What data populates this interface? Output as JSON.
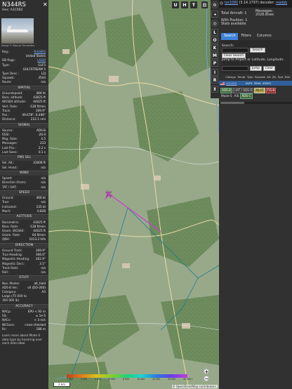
{
  "left_panel": {
    "callsign": "N344RS",
    "hex": "Hex:  A3C0B2",
    "photo_credit": "Image © Manuel Fernandez",
    "details": [
      {
        "label": "Reg.:",
        "value": "N344RS",
        "link": true
      },
      {
        "label": "",
        "value": "United States",
        "link": false
      },
      {
        "label": "DB flags:",
        "value": "LADD",
        "link": true
      },
      {
        "label": "Type:",
        "value": "GLF5",
        "link": false
      },
      {
        "label": "",
        "value": "GULFSTREAM 5",
        "link": false
      },
      {
        "label": "Type Desc.:",
        "value": "L2J",
        "link": false
      },
      {
        "label": "Squawk:",
        "value": "3544",
        "link": false
      },
      {
        "label": "Route:",
        "value": "n/a",
        "link": false
      }
    ],
    "sections": [
      {
        "title": "SPATIAL",
        "rows": [
          {
            "label": "Groundspeed:",
            "value": "466 kt"
          },
          {
            "label": "Baro. altitude:",
            "value": "43025 ft"
          },
          {
            "label": "WGS84 altitude:",
            "value": "44025 ft"
          },
          {
            "label": "Vert. Rate:",
            "value": "-128 ft/min"
          },
          {
            "label": "Track:",
            "value": "309.9°"
          },
          {
            "label": "Pos.:",
            "value": "49.678°, 6.496°"
          },
          {
            "label": "Distance:",
            "value": "212.1 nmi"
          }
        ]
      },
      {
        "title": "SIGNAL",
        "rows": [
          {
            "label": "Source:",
            "value": "ADS-B"
          },
          {
            "label": "RSSI:",
            "value": "-26.9"
          },
          {
            "label": "Msg. Rate:",
            "value": "4.5"
          },
          {
            "label": "Messages:",
            "value": "233"
          },
          {
            "label": "Last Pos.:",
            "value": "2.2 s"
          },
          {
            "label": "Last Seen:",
            "value": "0.1 s"
          }
        ]
      },
      {
        "title": "FMS SEL",
        "rows": [
          {
            "label": "Sel. Alt.:",
            "value": "43008 ft"
          },
          {
            "label": "Sel. Head.:",
            "value": "n/a"
          }
        ]
      },
      {
        "title": "WIND",
        "rows": [
          {
            "label": "Speed:",
            "value": "n/a"
          },
          {
            "label": "Direction (from):",
            "value": "n/a"
          },
          {
            "label": "TAT / OAT:",
            "value": "n/a"
          }
        ]
      },
      {
        "title": "SPEED",
        "rows": [
          {
            "label": "Ground:",
            "value": "466 kt"
          },
          {
            "label": "True:",
            "value": "n/a"
          },
          {
            "label": "Indicated:",
            "value": "235 kt"
          },
          {
            "label": "Mach:",
            "value": "0.828"
          }
        ]
      },
      {
        "title": "ALTITUDE",
        "rows": [
          {
            "label": "Barometric:",
            "value": "43025 ft"
          },
          {
            "label": "Baro. Rate:",
            "value": "-128 ft/min"
          },
          {
            "label": "Geom. WGS84:",
            "value": "44025 ft"
          },
          {
            "label": "Geom. Rate:",
            "value": "64 ft/min"
          },
          {
            "label": "QNH:",
            "value": "1013.2 hPa"
          }
        ]
      },
      {
        "title": "DIRECTION",
        "rows": [
          {
            "label": "Ground Track:",
            "value": "309.9°"
          },
          {
            "label": "True Heading:",
            "value": "306.0°"
          },
          {
            "label": "Magnetic Heading:",
            "value": "302.9°"
          },
          {
            "label": "Magnetic Decl.:",
            "value": "3.1°"
          },
          {
            "label": "Track Rate:",
            "value": "n/a"
          },
          {
            "label": "Roll:",
            "value": "n/a"
          }
        ]
      },
      {
        "title": "STUFF",
        "rows": [
          {
            "label": "Nav. Modes:",
            "value": "alt_hold"
          },
          {
            "label": "ADS-B Ver.:",
            "value": "v0 (DO-260)"
          },
          {
            "label": "Category:",
            "value": "A3"
          },
          {
            "label": "Large (75 000 to",
            "value": ""
          },
          {
            "label": "300 000 lb)",
            "value": ""
          }
        ]
      },
      {
        "title": "ACCURACY",
        "rows": [
          {
            "label": "NACp:",
            "value": "EPU < 92 m"
          },
          {
            "label": "SIL:",
            "value": "≤ 1e-5"
          },
          {
            "label": "NACv:",
            "value": "< 3 m/s"
          },
          {
            "label": "NICbaro:",
            "value": "cross-checked"
          },
          {
            "label": "Rc:",
            "value": "186 m"
          }
        ]
      }
    ],
    "footer_note": "Learn more about Mode S data type by hovering over each data label."
  },
  "map": {
    "top_buttons": [
      "U",
      "H",
      "T"
    ],
    "zoom_in": "+",
    "zoom_out": "−",
    "scale_label": "2 km",
    "altitude_labels": [
      "1 000",
      "2 000",
      "4 000",
      "6 000",
      "8 000",
      "10 000",
      "20 000",
      "30 000",
      "40 000+"
    ],
    "attribution": "© OpenStreetMap contributors."
  },
  "nav_buttons": [
    "L",
    "O",
    "K",
    "M",
    "P",
    "I",
    "R"
  ],
  "right_panel": {
    "version_link": "tar1090",
    "version_text": "(3.14.1797) decoder:",
    "decoder_link": "readsb",
    "total_aircraft_label": "Total Aircraft:",
    "total_aircraft": "1",
    "messages_label": "Messages:",
    "messages_value": "2028.8/sec",
    "with_position": "With Position: 1",
    "stats_available": "Stats available",
    "tabs": [
      "Search",
      "Filters",
      "Columns"
    ],
    "search_label": "Search:",
    "search_button": "Search",
    "clear_search_button": "Clear Search",
    "jump_label": "Jump to Airport or Latitude, Longitude:",
    "jump_button": "Jump",
    "clear_button": "Clear",
    "table_headers": [
      "Callsign",
      "Route",
      "Type",
      "Squawk",
      "Alt. (ft)",
      "Spd",
      "Dist"
    ],
    "table_row": {
      "callsign": "N344RS",
      "type": "GLF5",
      "squawk": "3544",
      "alt": "43025"
    },
    "legend": [
      "ADS-B",
      "UAT / ADS-R",
      "MLAT",
      "TIS-B",
      "Mode-S",
      "AIS",
      "ADS-C"
    ]
  }
}
